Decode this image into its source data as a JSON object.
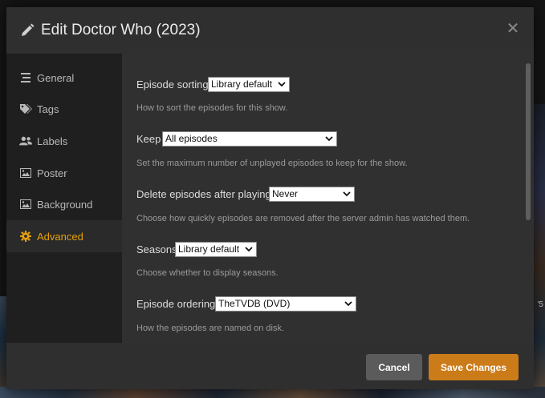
{
  "modal": {
    "title": "Edit Doctor Who (2023)"
  },
  "sidebar": {
    "items": [
      {
        "label": "General",
        "icon": "list-icon",
        "active": false
      },
      {
        "label": "Tags",
        "icon": "tag-icon",
        "active": false
      },
      {
        "label": "Labels",
        "icon": "users-icon",
        "active": false
      },
      {
        "label": "Poster",
        "icon": "image-icon",
        "active": false
      },
      {
        "label": "Background",
        "icon": "image-icon",
        "active": true
      },
      {
        "label": "Advanced",
        "icon": "gear-icon",
        "active": true
      }
    ]
  },
  "settings": {
    "episode_sorting": {
      "label": "Episode sorting",
      "value": "Library default",
      "help": "How to sort the episodes for this show."
    },
    "keep": {
      "label": "Keep",
      "value": "All episodes",
      "help": "Set the maximum number of unplayed episodes to keep for the show."
    },
    "delete_after": {
      "label": "Delete episodes after playing",
      "value": "Never",
      "help": "Choose how quickly episodes are removed after the server admin has watched them."
    },
    "seasons": {
      "label": "Seasons",
      "value": "Library default",
      "help": "Choose whether to display seasons."
    },
    "episode_ordering": {
      "label": "Episode ordering",
      "value": "TheTVDB (DVD)",
      "help": "How the episodes are named on disk."
    }
  },
  "footer": {
    "cancel_label": "Cancel",
    "save_label": "Save Changes"
  },
  "background_text": "'5",
  "colors": {
    "accent": "#e5a00d",
    "save_button": "#cc7b19",
    "cancel_button": "#5b5b5b"
  }
}
